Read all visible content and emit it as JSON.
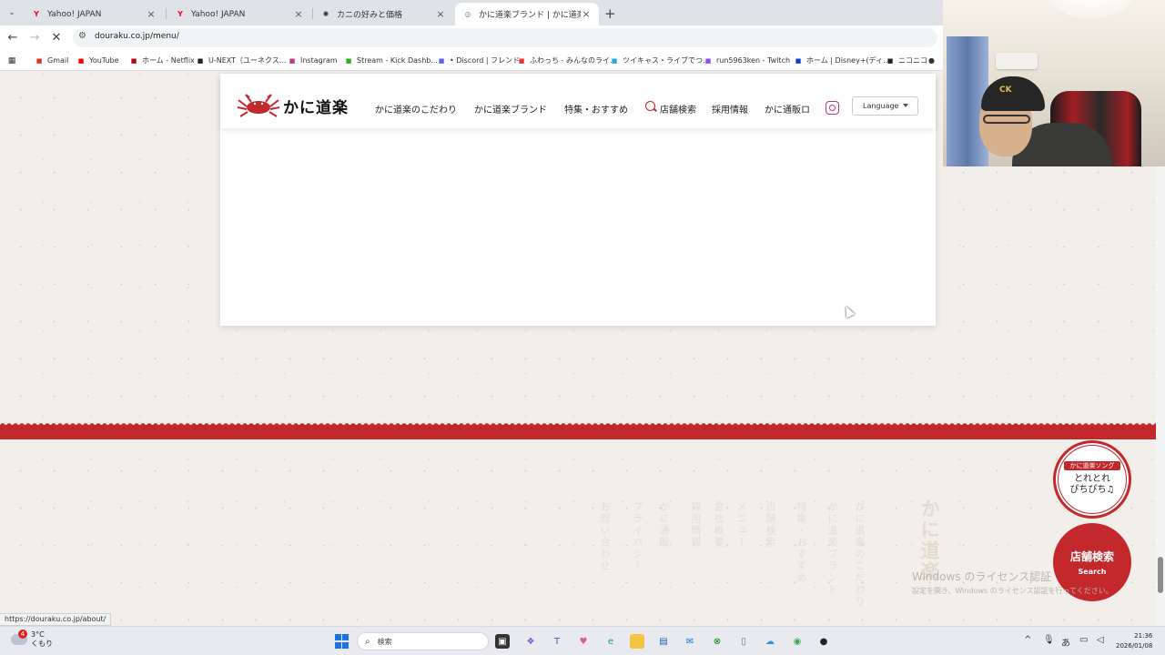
{
  "browser": {
    "tabs": [
      {
        "title": "Yahoo! JAPAN",
        "icon": "yahoo-icon",
        "active": false
      },
      {
        "title": "Yahoo! JAPAN",
        "icon": "yahoo-icon",
        "active": false
      },
      {
        "title": "カニの好みと価格",
        "icon": "chatgpt-icon",
        "active": false
      },
      {
        "title": "かに道楽ブランド | かに道楽 | かに道",
        "icon": "site-icon",
        "active": true
      }
    ],
    "url": "douraku.co.jp/menu/",
    "bookmarks": [
      {
        "label": "Gmail",
        "icon": "gmail-icon",
        "color": "#d93025"
      },
      {
        "label": "YouTube",
        "icon": "youtube-icon",
        "color": "#ff0000"
      },
      {
        "label": "ホーム - Netflix",
        "icon": "netflix-icon",
        "color": "#b20710"
      },
      {
        "label": "U-NEXT（ユーネクス...",
        "icon": "unext-icon",
        "color": "#222222"
      },
      {
        "label": "Instagram",
        "icon": "instagram-icon",
        "color": "#c13584"
      },
      {
        "label": "Stream - Kick Dashb...",
        "icon": "kick-icon",
        "color": "#2bb01b"
      },
      {
        "label": "• Discord | フレンド",
        "icon": "discord-icon",
        "color": "#5865f2"
      },
      {
        "label": "ふわっち - みんなのライ...",
        "icon": "fuwacchi-icon",
        "color": "#e33"
      },
      {
        "label": "ツイキャス・ライブでつ...",
        "icon": "twitcasting-icon",
        "color": "#2aa8e0"
      },
      {
        "label": "run5963ken - Twitch",
        "icon": "twitch-icon",
        "color": "#9146ff"
      },
      {
        "label": "ホーム | Disney+(ディ...",
        "icon": "disney-icon",
        "color": "#113ccf"
      },
      {
        "label": "ニコニコ",
        "icon": "niconico-icon",
        "color": "#222222"
      }
    ]
  },
  "site": {
    "logo_text": "かに道楽",
    "nav": [
      "かに道楽のこだわり",
      "かに道楽ブランド",
      "特集・おすすめ",
      "店舗検索",
      "採用情報",
      "かに通販ロ"
    ],
    "language_label": "Language",
    "footer_columns": [
      "かに道楽",
      "かに道楽のこだわり",
      "かに道楽ブランド",
      "特集・おすすめ",
      "店舗検索",
      "メニュー",
      "会社概要",
      "採用情報",
      "かに通販",
      "プライバシー",
      "お問い合わせ"
    ],
    "song_tag": "かに道楽ソング",
    "song_line1": "とれとれ",
    "song_line2": "ぴちぴち♫",
    "shop_title": "店舗検索",
    "shop_sub": "Search",
    "accent_color": "#c3282d"
  },
  "status_url": "https://douraku.co.jp/about/",
  "windows": {
    "activation_title": "Windows のライセンス認証",
    "activation_sub": "設定を開き、Windows のライセンス認証を行ってください。",
    "weather_temp": "3°C",
    "weather_desc": "くもり",
    "weather_badge": "4",
    "search_placeholder": "検索",
    "time": "21:36",
    "date": "2026/01/08"
  }
}
